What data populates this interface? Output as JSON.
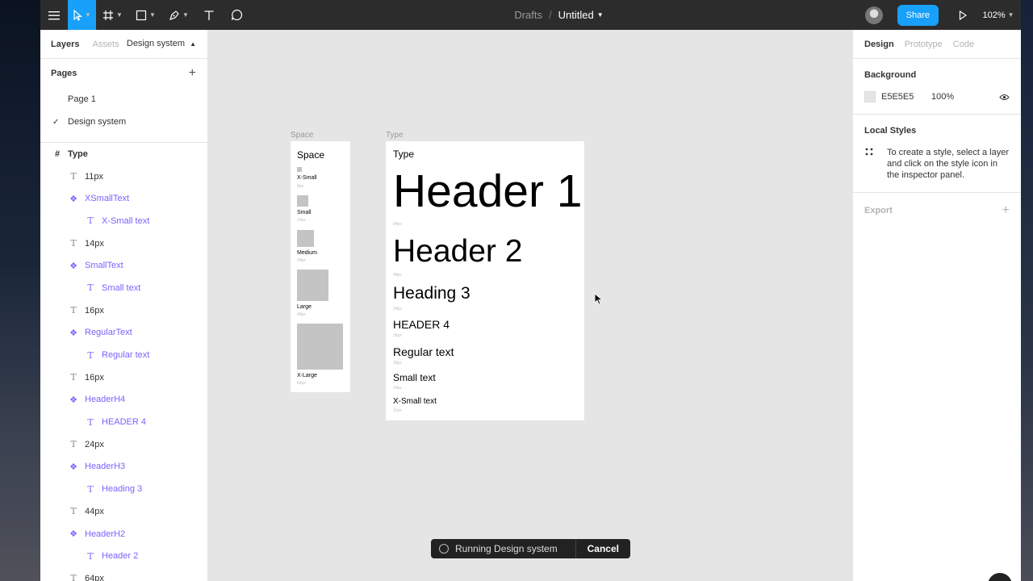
{
  "topbar": {
    "breadcrumb_parent": "Drafts",
    "breadcrumb_sep": "/",
    "file_title": "Untitled",
    "share_label": "Share",
    "zoom_label": "102%"
  },
  "left_panel": {
    "tabs": [
      "Layers",
      "Assets"
    ],
    "page_dropdown": "Design system",
    "pages_title": "Pages",
    "pages": [
      "Page 1",
      "Design system"
    ],
    "current_page": "Design system",
    "layers": [
      {
        "name": "Type",
        "kind": "frame",
        "level": 0
      },
      {
        "name": "11px",
        "kind": "text",
        "level": 1
      },
      {
        "name": "XSmallText",
        "kind": "component",
        "level": 1
      },
      {
        "name": "X-Small text",
        "kind": "instance-text",
        "level": 2
      },
      {
        "name": "14px",
        "kind": "text",
        "level": 1
      },
      {
        "name": "SmallText",
        "kind": "component",
        "level": 1
      },
      {
        "name": "Small text",
        "kind": "instance-text",
        "level": 2
      },
      {
        "name": "16px",
        "kind": "text",
        "level": 1
      },
      {
        "name": "RegularText",
        "kind": "component",
        "level": 1
      },
      {
        "name": "Regular text",
        "kind": "instance-text",
        "level": 2
      },
      {
        "name": "16px",
        "kind": "text",
        "level": 1
      },
      {
        "name": "HeaderH4",
        "kind": "component",
        "level": 1
      },
      {
        "name": "HEADER 4",
        "kind": "instance-text",
        "level": 2
      },
      {
        "name": "24px",
        "kind": "text",
        "level": 1
      },
      {
        "name": "HeaderH3",
        "kind": "component",
        "level": 1
      },
      {
        "name": "Heading 3",
        "kind": "instance-text",
        "level": 2
      },
      {
        "name": "44px",
        "kind": "text",
        "level": 1
      },
      {
        "name": "HeaderH2",
        "kind": "component",
        "level": 1
      },
      {
        "name": "Header 2",
        "kind": "instance-text",
        "level": 2
      },
      {
        "name": "64px",
        "kind": "text",
        "level": 1
      }
    ]
  },
  "right_panel": {
    "tabs": [
      "Design",
      "Prototype",
      "Code"
    ],
    "background_title": "Background",
    "background_hex": "E5E5E5",
    "background_opacity": "100%",
    "local_styles_title": "Local Styles",
    "local_styles_hint": "To create a style, select a layer and click on the style icon in the inspector panel.",
    "export_title": "Export"
  },
  "canvas": {
    "space_label": "Space",
    "type_label": "Type",
    "space_frame": {
      "title": "Space",
      "items": [
        {
          "name": "X-Small",
          "size": "8px"
        },
        {
          "name": "Small",
          "size": "14px"
        },
        {
          "name": "Medium",
          "size": "24px"
        },
        {
          "name": "Large",
          "size": "44px"
        },
        {
          "name": "X-Large",
          "size": "64px"
        }
      ]
    },
    "type_frame": {
      "title": "Type",
      "items": [
        {
          "text": "Header 1",
          "size": "64px"
        },
        {
          "text": "Header 2",
          "size": "44px"
        },
        {
          "text": "Heading 3",
          "size": "24px"
        },
        {
          "text": "HEADER 4",
          "size": "16px"
        },
        {
          "text": "Regular text",
          "size": "16px"
        },
        {
          "text": "Small text",
          "size": "14px"
        },
        {
          "text": "X-Small text",
          "size": "11px"
        }
      ]
    }
  },
  "toast": {
    "message": "Running Design system",
    "cancel_label": "Cancel"
  },
  "colors": {
    "accent": "#18a0fb",
    "component": "#7b61ff",
    "toolbar": "#2c2c2c",
    "canvas": "#e5e5e5"
  }
}
